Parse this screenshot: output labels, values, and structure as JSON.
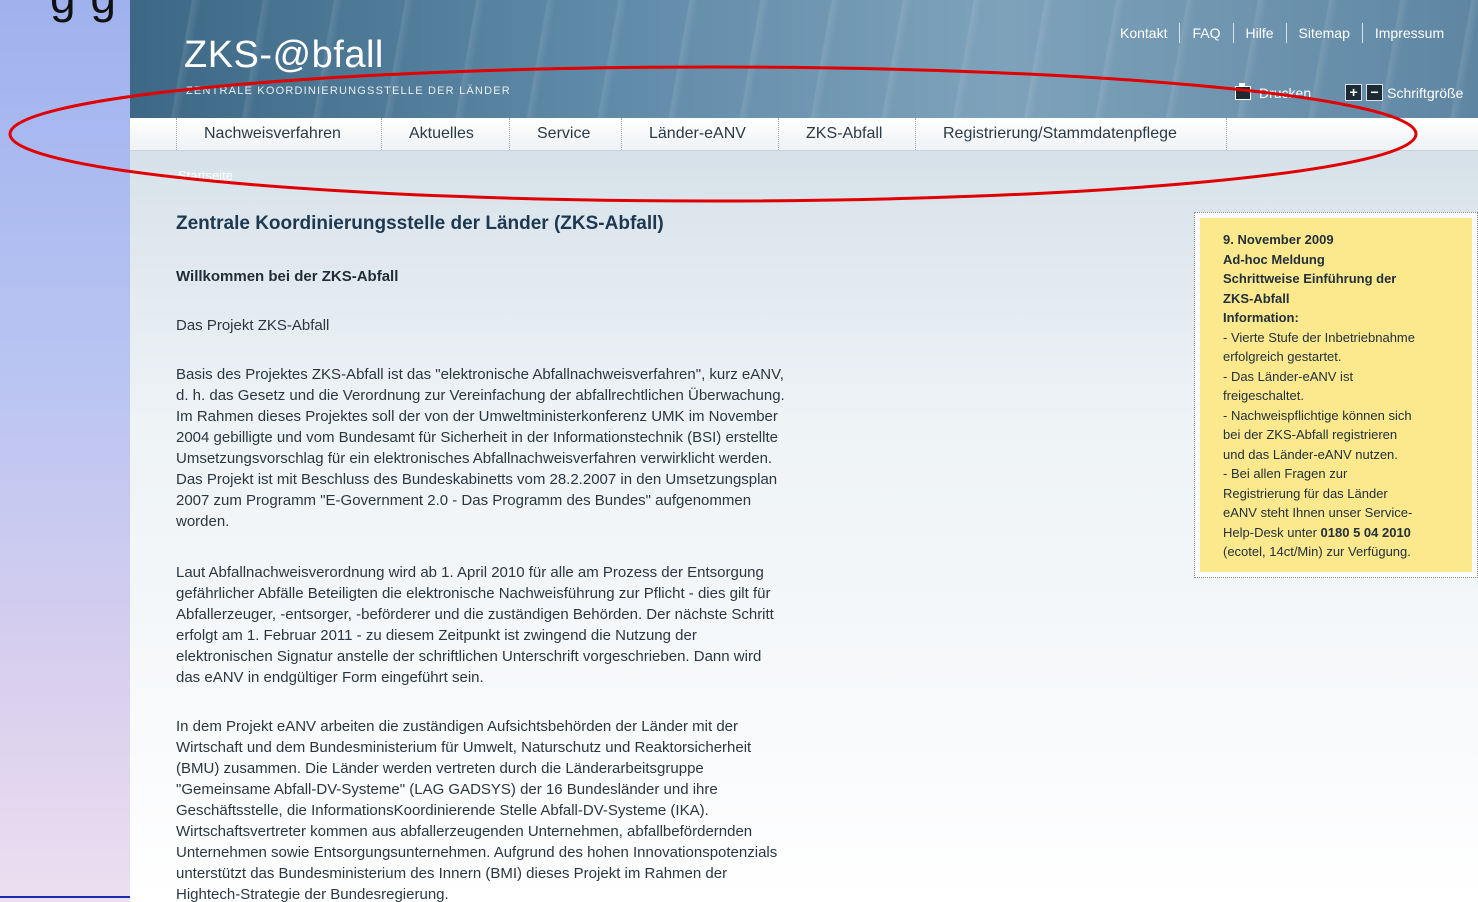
{
  "slide": {
    "title_fragment": "g   g"
  },
  "site": {
    "logo": "ZKS-@bfall",
    "logo_subtitle": "ZENTRALE KOORDINIERUNGSSTELLE DER LÄNDER",
    "top_links": [
      "Kontakt",
      "FAQ",
      "Hilfe",
      "Sitemap",
      "Impressum"
    ],
    "print_label": "Drucken",
    "font_size_label": "Schriftgröße"
  },
  "nav": {
    "items": [
      "Nachweisverfahren",
      "Aktuelles",
      "Service",
      "Länder-eANV",
      "ZKS-Abfall",
      "Registrierung/Stammdatenpflege"
    ]
  },
  "breadcrumb": "Startseite",
  "main": {
    "title": "Zentrale Koordinierungsstelle der Länder (ZKS-Abfall)",
    "welcome": "Willkommen bei der ZKS-Abfall",
    "project_heading": "Das Projekt ZKS-Abfall",
    "para1": [
      "Basis des Projektes ZKS-Abfall ist das \"elektronische Abfallnachweisverfahren\", kurz eANV,",
      "d. h. das Gesetz und die Verordnung zur Vereinfachung der abfallrechtlichen Überwachung.",
      "Im Rahmen dieses Projektes soll der von der Umweltministerkonferenz UMK im November",
      "2004 gebilligte und vom Bundesamt für Sicherheit in der Informationstechnik (BSI) erstellte",
      "Umsetzungsvorschlag für ein elektronisches Abfallnachweisverfahren verwirklicht werden.",
      "Das Projekt ist mit Beschluss des Bundeskabinetts vom 28.2.2007 in den Umsetzungsplan",
      "2007 zum Programm \"E-Government 2.0 - Das Programm des Bundes\" aufgenommen",
      "worden."
    ],
    "para2": [
      "Laut Abfallnachweisverordnung wird ab 1. April 2010 für alle am Prozess der Entsorgung",
      "gefährlicher Abfälle Beteiligten die elektronische Nachweisführung zur Pflicht - dies gilt für",
      "Abfallerzeuger, -entsorger, -beförderer und die zuständigen Behörden. Der nächste Schritt",
      "erfolgt am 1. Februar 2011 - zu diesem Zeitpunkt ist zwingend die Nutzung der",
      "elektronischen Signatur anstelle der schriftlichen Unterschrift vorgeschrieben. Dann wird",
      "das eANV in endgültiger Form eingeführt sein."
    ],
    "para3": [
      "In dem Projekt eANV arbeiten die zuständigen Aufsichtsbehörden der Länder mit der",
      "Wirtschaft und dem Bundesministerium für Umwelt, Naturschutz und Reaktorsicherheit",
      "(BMU) zusammen. Die Länder werden vertreten durch die Länderarbeitsgruppe",
      "\"Gemeinsame Abfall-DV-Systeme\" (LAG GADSYS) der 16 Bundesländer und ihre",
      "Geschäftsstelle, die InformationsKoordinierende Stelle Abfall-DV-Systeme (IKA).",
      "Wirtschaftsvertreter kommen aus abfallerzeugenden Unternehmen, abfallbefördernden",
      "Unternehmen sowie Entsorgungsunternehmen. Aufgrund des hohen Innovationspotenzials",
      "unterstützt das Bundesministerium des Innern (BMI) dieses Projekt im Rahmen der",
      "Hightech-Strategie der Bundesregierung."
    ]
  },
  "news": {
    "bold_lines": [
      "9. November 2009",
      "Ad-hoc Meldung",
      "Schrittweise Einführung der",
      "ZKS-Abfall",
      "Information:"
    ],
    "lines": [
      "- Vierte Stufe der Inbetriebnahme",
      "erfolgreich gestartet.",
      "- Das Länder-eANV ist",
      "freigeschaltet.",
      "- Nachweispflichtige können sich",
      "bei der ZKS-Abfall registrieren",
      "und das Länder-eANV nutzen.",
      "- Bei allen Fragen zur",
      "Registrierung für das Länder",
      "eANV steht Ihnen unser Service-"
    ],
    "helpdesk_prefix": "Help-Desk unter ",
    "helpdesk_phone": "0180 5 04 2010",
    "last_line": "(ecotel, 14ct/Min) zur Verfügung."
  },
  "colors": {
    "annotation": "#e00000",
    "news_bg": "#fde98d",
    "title": "#1d3850"
  }
}
